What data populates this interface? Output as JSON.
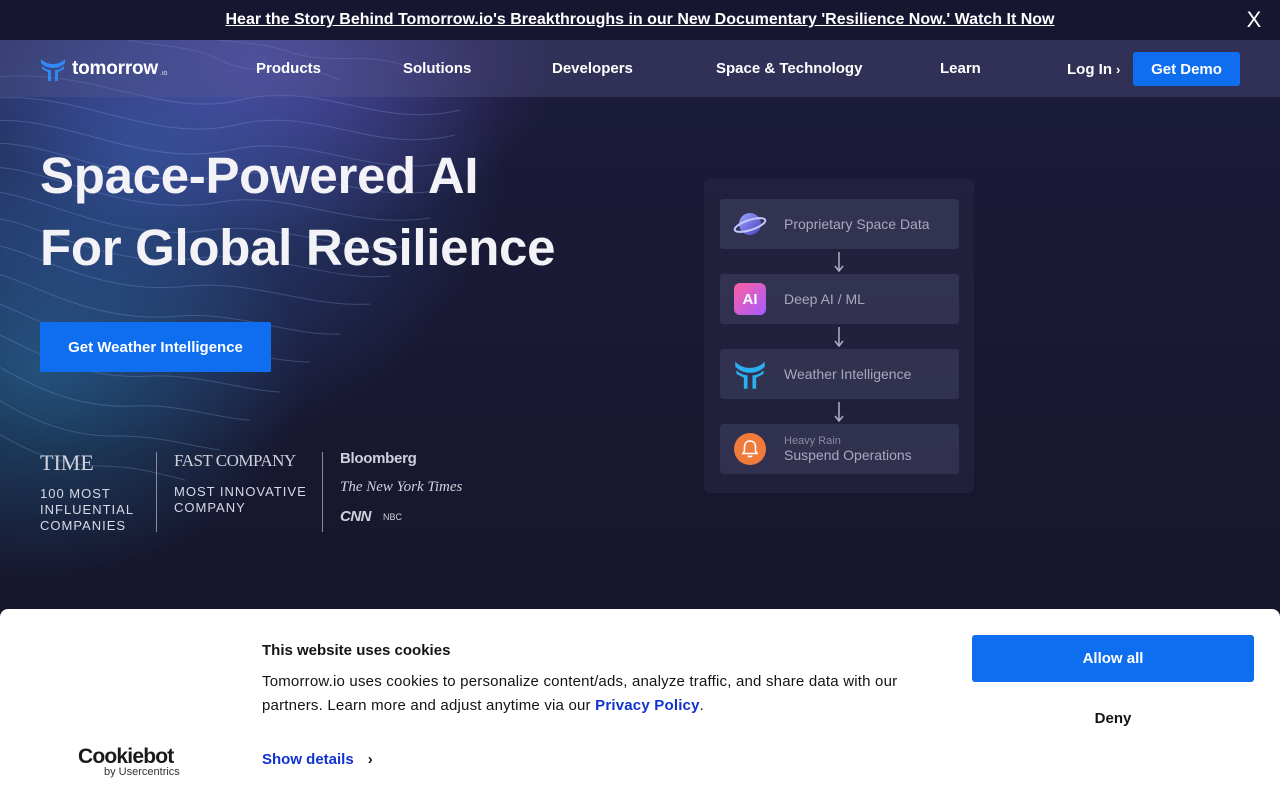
{
  "announcement": {
    "text": "Hear the Story Behind Tomorrow.io's Breakthroughs in our New Documentary 'Resilience Now.' Watch It Now",
    "close_label": "X"
  },
  "nav": {
    "logo_text": "tomorrow",
    "logo_suffix": ".io",
    "items": [
      "Products",
      "Solutions",
      "Developers",
      "Space & Technology",
      "Learn"
    ],
    "login_label": "Log In",
    "demo_label": "Get Demo"
  },
  "hero": {
    "headline_line1": "Space-Powered AI",
    "headline_line2": "For Global Resilience",
    "cta_label": "Get Weather Intelligence"
  },
  "press": {
    "time_logo": "TIME",
    "time_caption": [
      "100 MOST",
      "INFLUENTIAL",
      "COMPANIES"
    ],
    "fastco_logo": "FAST COMPANY",
    "fastco_caption": [
      "MOST INNOVATIVE",
      "COMPANY"
    ],
    "bloomberg_logo": "Bloomberg",
    "nyt_logo": "The New York Times",
    "cnn_logo": "CNN",
    "nbc_logo": "NBC"
  },
  "flow": {
    "steps": [
      {
        "label": "Proprietary Space Data",
        "icon": "planet-icon"
      },
      {
        "label": "Deep AI / ML",
        "icon": "ai-icon",
        "icon_text": "AI"
      },
      {
        "label": "Weather Intelligence",
        "icon": "tomorrow-logo-icon"
      },
      {
        "sublabel": "Heavy Rain",
        "label": "Suspend Operations",
        "icon": "bell-icon"
      }
    ]
  },
  "cookie": {
    "brand": "Cookiebot",
    "brand_sub": "by Usercentrics",
    "title": "This website uses cookies",
    "text_before": "Tomorrow.io uses cookies to personalize content/ads, analyze traffic, and share data with our partners. Learn more and adjust anytime via our ",
    "policy_link": "Privacy Policy",
    "text_after": ".",
    "show_details": "Show details",
    "allow_label": "Allow all",
    "deny_label": "Deny"
  },
  "colors": {
    "accent": "#0f6ef0",
    "link": "#1032cf",
    "background": "#15152b"
  }
}
